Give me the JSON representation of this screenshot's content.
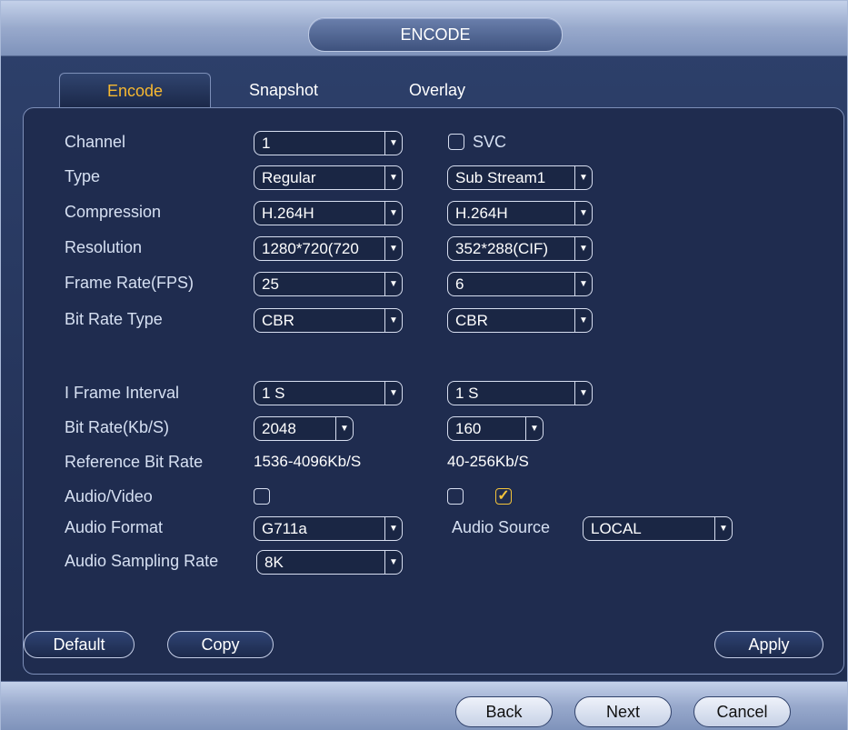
{
  "window": {
    "title": "ENCODE"
  },
  "tabs": [
    {
      "label": "Encode",
      "active": true
    },
    {
      "label": "Snapshot",
      "active": false
    },
    {
      "label": "Overlay",
      "active": false
    }
  ],
  "colors": {
    "active_tab": "#f6b830",
    "panel_bg": "#1f2c4f",
    "bar_bg": "#98a9cc"
  },
  "form": {
    "channel": {
      "label": "Channel",
      "value": "1"
    },
    "svc": {
      "label": "SVC",
      "checked": false
    },
    "type": {
      "label": "Type",
      "main": "Regular",
      "sub": "Sub Stream1"
    },
    "compression": {
      "label": "Compression",
      "main": "H.264H",
      "sub": "H.264H"
    },
    "resolution": {
      "label": "Resolution",
      "main": "1280*720(720",
      "sub": "352*288(CIF)"
    },
    "frame_rate": {
      "label": "Frame Rate(FPS)",
      "main": "25",
      "sub": "6"
    },
    "bit_rate_type": {
      "label": "Bit Rate Type",
      "main": "CBR",
      "sub": "CBR"
    },
    "i_frame": {
      "label": "I Frame Interval",
      "main": "1 S",
      "sub": "1 S"
    },
    "bit_rate": {
      "label": "Bit Rate(Kb/S)",
      "main": "2048",
      "sub": "160"
    },
    "reference_bit_rate": {
      "label": "Reference Bit Rate",
      "main": "1536-4096Kb/S",
      "sub": "40-256Kb/S"
    },
    "audio_video": {
      "label": "Audio/Video",
      "main_checked": false,
      "sub_checked": false,
      "sub_audio_checked": true
    },
    "audio_format": {
      "label": "Audio Format",
      "value": "G711a"
    },
    "audio_source": {
      "label": "Audio Source",
      "value": "LOCAL"
    },
    "audio_sampling": {
      "label": "Audio Sampling Rate",
      "value": "8K"
    }
  },
  "buttons": {
    "default": "Default",
    "copy": "Copy",
    "apply": "Apply"
  },
  "nav": {
    "back": "Back",
    "next": "Next",
    "cancel": "Cancel"
  },
  "icons": {
    "dropdown": "chevron-down-icon",
    "check": "check-icon"
  }
}
